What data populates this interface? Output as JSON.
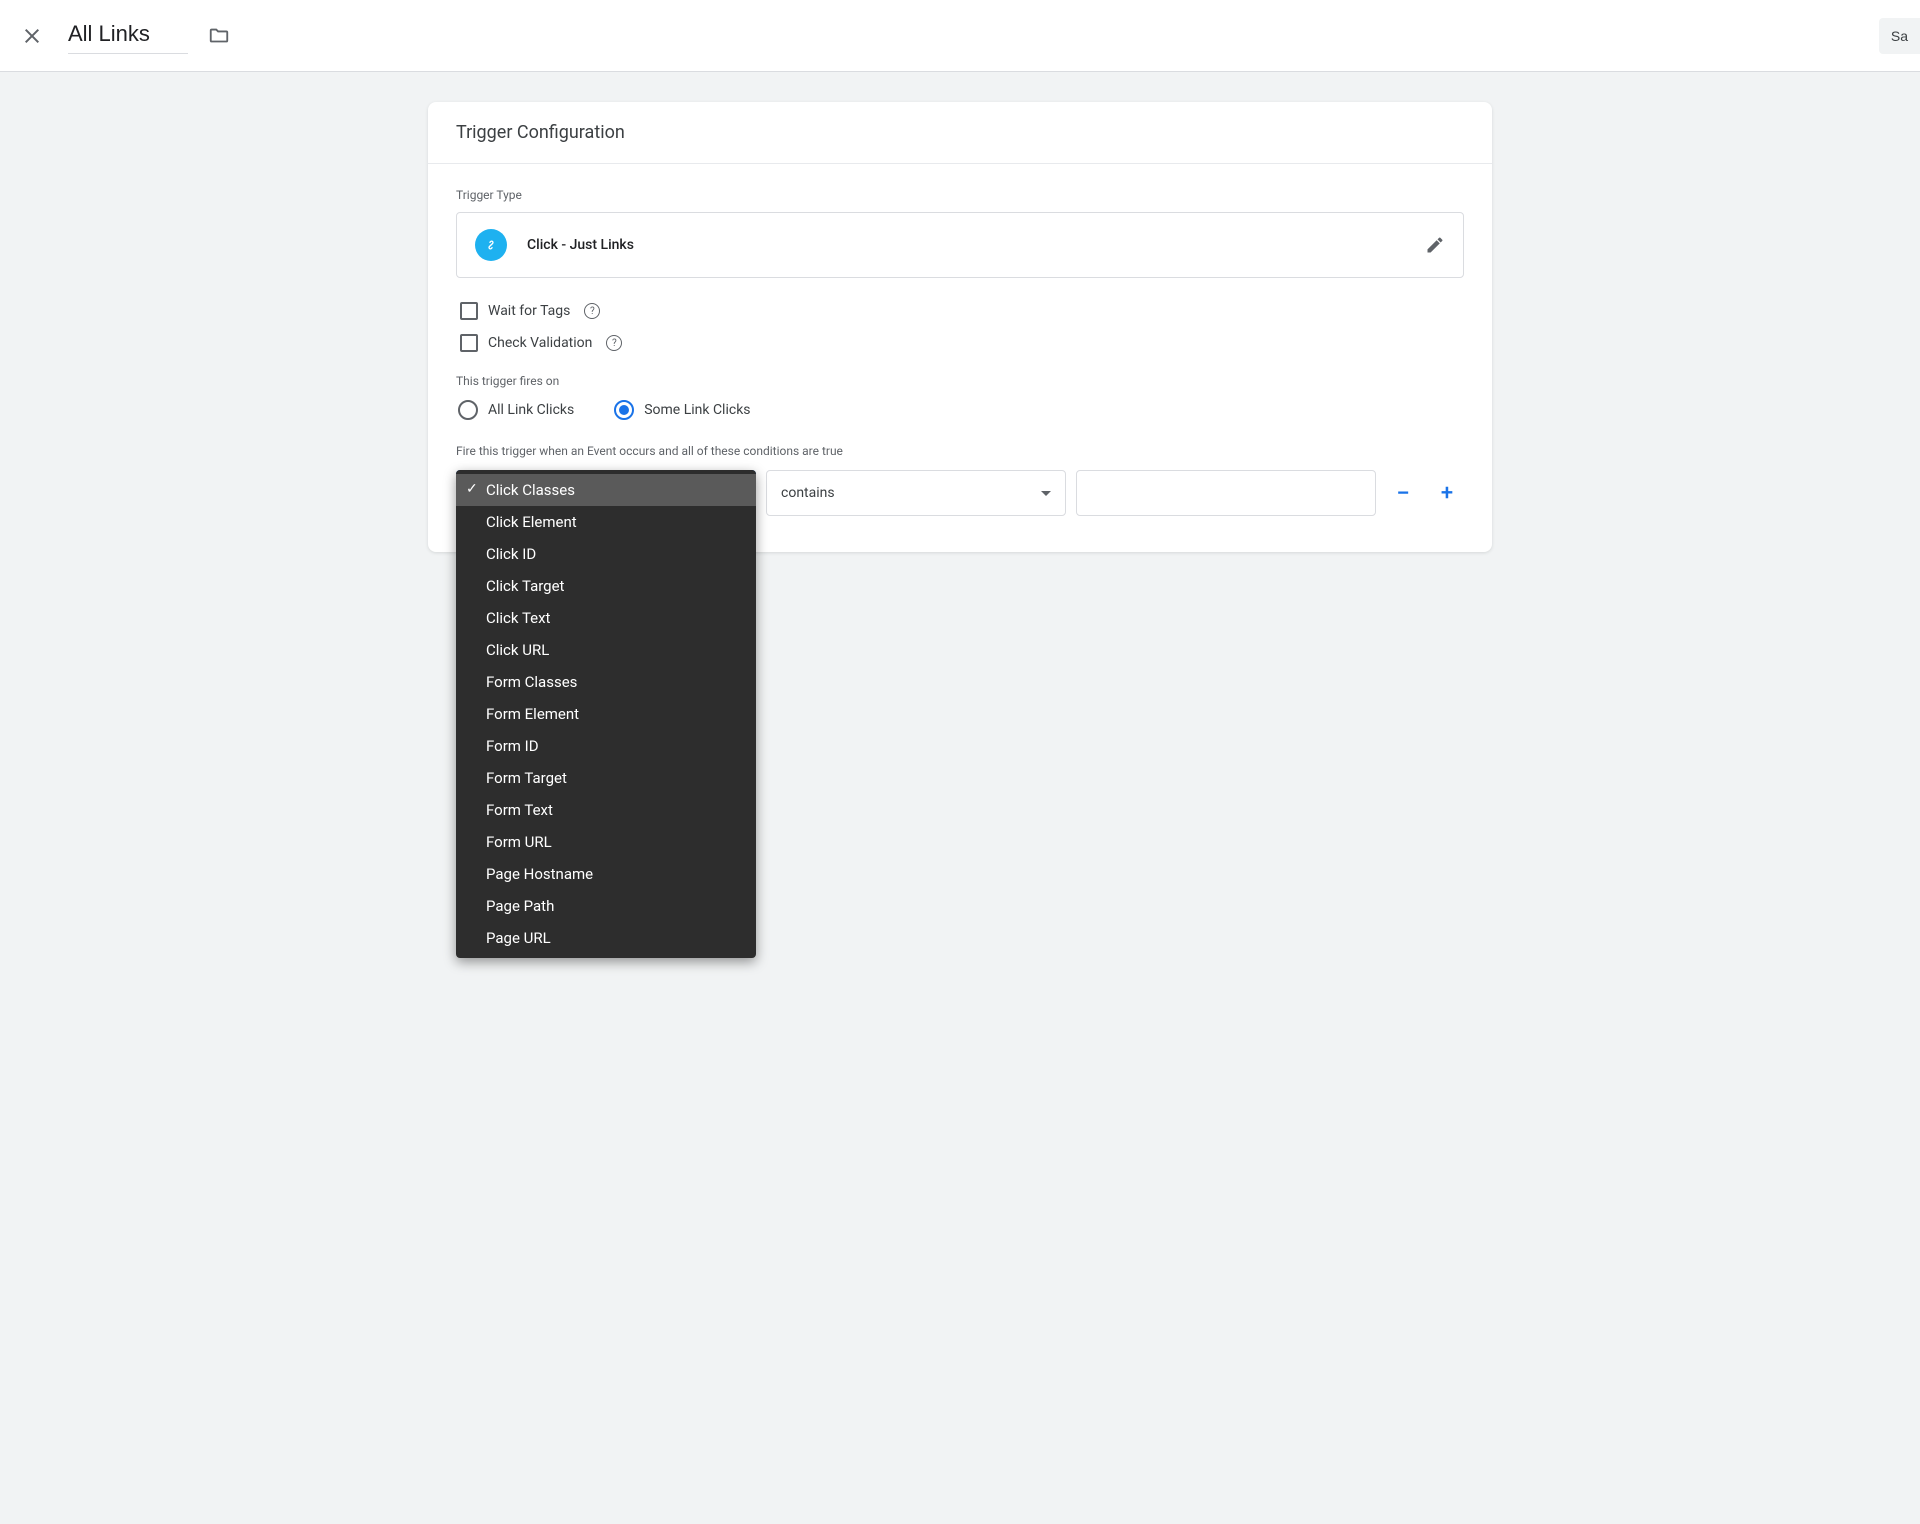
{
  "header": {
    "title_value": "All Links",
    "save_label": "Sa"
  },
  "card": {
    "title": "Trigger Configuration",
    "trigger_type_label": "Trigger Type",
    "trigger_type_name": "Click - Just Links",
    "wait_for_tags_label": "Wait for Tags",
    "check_validation_label": "Check Validation",
    "fires_on_label": "This trigger fires on",
    "radio_all": "All Link Clicks",
    "radio_some": "Some Link Clicks",
    "conditions_label": "Fire this trigger when an Event occurs and all of these conditions are true",
    "condition": {
      "variable_selected": "Click Classes",
      "operator_selected": "contains",
      "value": ""
    }
  },
  "variable_menu": {
    "selected_index": 0,
    "items": [
      "Click Classes",
      "Click Element",
      "Click ID",
      "Click Target",
      "Click Text",
      "Click URL",
      "Form Classes",
      "Form Element",
      "Form ID",
      "Form Target",
      "Form Text",
      "Form URL",
      "Page Hostname",
      "Page Path",
      "Page URL"
    ]
  }
}
